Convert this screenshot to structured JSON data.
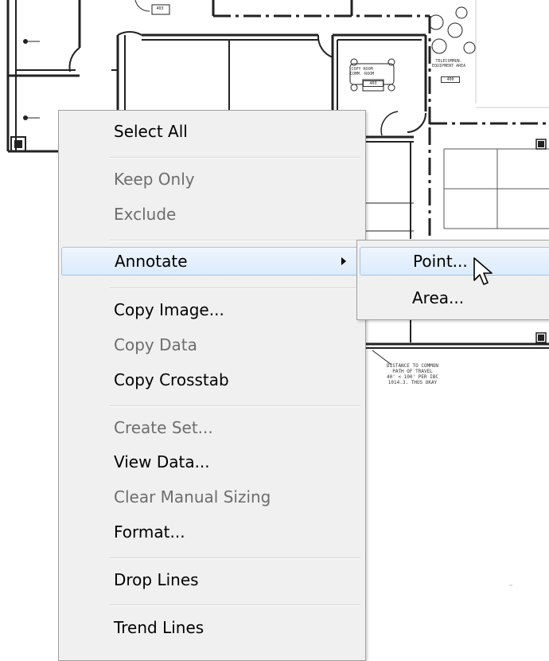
{
  "context_menu": {
    "items": [
      {
        "label": "Select All",
        "enabled": true
      },
      {
        "label": "Keep Only",
        "enabled": false
      },
      {
        "label": "Exclude",
        "enabled": false
      },
      {
        "label": "Annotate",
        "enabled": true,
        "highlighted": true,
        "has_submenu": true
      },
      {
        "label": "Copy Image...",
        "enabled": true
      },
      {
        "label": "Copy Data",
        "enabled": false
      },
      {
        "label": "Copy Crosstab",
        "enabled": true
      },
      {
        "label": "Create Set...",
        "enabled": false
      },
      {
        "label": "View Data...",
        "enabled": true
      },
      {
        "label": "Clear Manual Sizing",
        "enabled": false
      },
      {
        "label": "Format...",
        "enabled": true
      },
      {
        "label": "Drop Lines",
        "enabled": true
      },
      {
        "label": "Trend Lines",
        "enabled": true
      }
    ]
  },
  "submenu": {
    "items": [
      {
        "label": "Point...",
        "highlighted": true
      },
      {
        "label": "Area...",
        "highlighted": false
      }
    ]
  },
  "floorplan": {
    "room_tag_1": "403",
    "room_tag_2": "COPY ROOM\nCOMM. ROOM",
    "room_tag_2_num": "403",
    "room_tag_3": "TELECOMMUN.\nEQUIPMENT AREA",
    "room_tag_3_num": "400",
    "note": "DISTANCE TO COMMON\nPATH OF TRAVEL\n40' < 100' PER IBC\n1014.3. THUS OKAY"
  },
  "colors": {
    "menu_bg": "#f0f0f0",
    "highlight_border": "#9ec5ee",
    "disabled_text": "#6d6d6d"
  }
}
